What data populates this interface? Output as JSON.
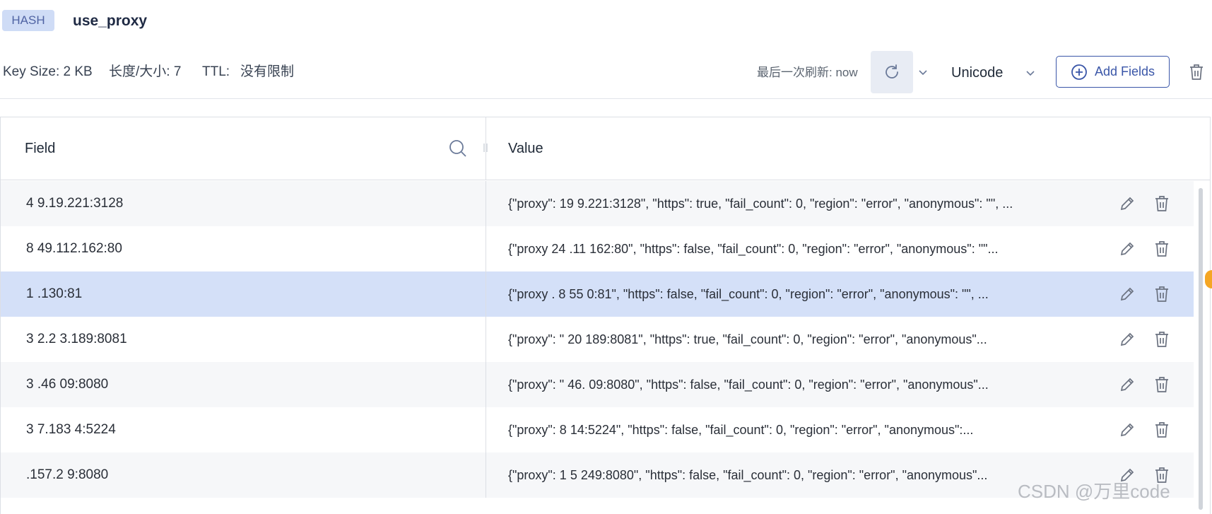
{
  "header": {
    "type_badge": "HASH",
    "key_name": "use_proxy"
  },
  "meta": {
    "key_size": "Key Size: 2 KB",
    "length": "长度/大小: 7",
    "ttl_label": "TTL:",
    "ttl_value": "没有限制",
    "last_refresh": "最后一次刷新: now",
    "encoding": "Unicode",
    "add_fields_label": "Add Fields"
  },
  "table": {
    "columns": {
      "field": "Field",
      "value": "Value"
    },
    "rows": [
      {
        "field": "4 9.19.221:3128",
        "value": "{\"proxy\":  19 9.221:3128\", \"https\": true, \"fail_count\": 0, \"region\": \"error\", \"anonymous\": \"\", ...",
        "state": "alt"
      },
      {
        "field": "8  49.112.162:80",
        "value": "{\"proxy  24 .11 162:80\", \"https\": false, \"fail_count\": 0, \"region\": \"error\", \"anonymous\": \"\"...",
        "state": "normal"
      },
      {
        "field": "1  .130:81",
        "value": "{\"proxy .  8  55  0:81\", \"https\": false, \"fail_count\": 0, \"region\": \"error\", \"anonymous\": \"\", ...",
        "state": "selected"
      },
      {
        "field": "3  2.2 3.189:8081",
        "value": "{\"proxy\": \"  20  189:8081\", \"https\": true, \"fail_count\": 0, \"region\": \"error\", \"anonymous\"...",
        "state": "normal"
      },
      {
        "field": "3  .46  09:8080",
        "value": "{\"proxy\": \"  46.  09:8080\", \"https\": false, \"fail_count\": 0, \"region\": \"error\", \"anonymous\"...",
        "state": "alt"
      },
      {
        "field": "3 7.183  4:5224",
        "value": "{\"proxy\":   8  14:5224\", \"https\": false, \"fail_count\": 0, \"region\": \"error\", \"anonymous\":...",
        "state": "normal"
      },
      {
        "field": "  .157.2 9:8080",
        "value": "{\"proxy\":   1  5  249:8080\", \"https\": false, \"fail_count\": 0, \"region\": \"error\", \"anonymous\"...",
        "state": "alt"
      }
    ]
  },
  "watermark": "CSDN @万里code",
  "colors": {
    "accent": "#3a56a8",
    "badge_bg": "#cfdcf6",
    "selected_row": "#d4e0f8",
    "alt_row": "#f6f7f9"
  },
  "icons": {
    "refresh": "refresh-icon",
    "add": "plus-circle-icon",
    "delete": "trash-icon",
    "edit": "pencil-icon",
    "search": "search-icon"
  }
}
